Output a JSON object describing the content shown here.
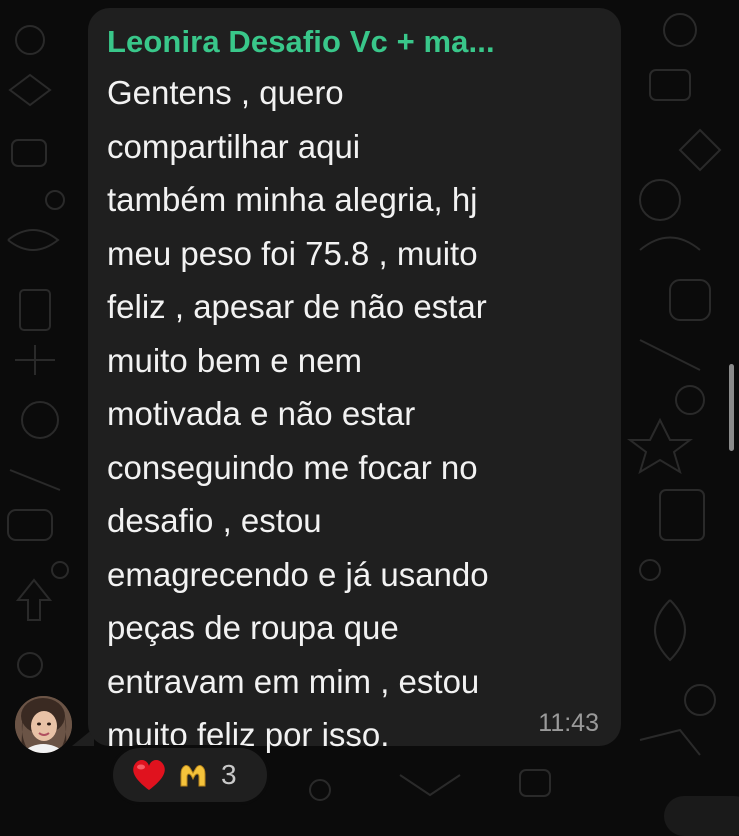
{
  "message": {
    "sender": "Leonira Desafio Vc + ma...",
    "lines": [
      "Gentens , quero",
      "compartilhar aqui",
      "também minha alegria, hj",
      "meu peso foi 75.8 , muito",
      "feliz , apesar de não estar",
      "muito bem e nem",
      "motivada e não estar",
      "conseguindo me focar no",
      "desafio , estou",
      "emagrecendo e já usando",
      "peças de roupa que",
      "entravam em mim , estou",
      "muito feliz por isso."
    ],
    "time": "11:43"
  },
  "reactions": {
    "emojis": [
      "heart-icon",
      "heart-hands-icon"
    ],
    "count": "3"
  },
  "colors": {
    "background": "#0b0b0b",
    "bubble": "#1f1f1f",
    "sender": "#39c78a",
    "text": "#f2f2f2",
    "timestamp": "#9a9a9a",
    "heart": "#e0121e",
    "hands": "#f5c33b"
  }
}
